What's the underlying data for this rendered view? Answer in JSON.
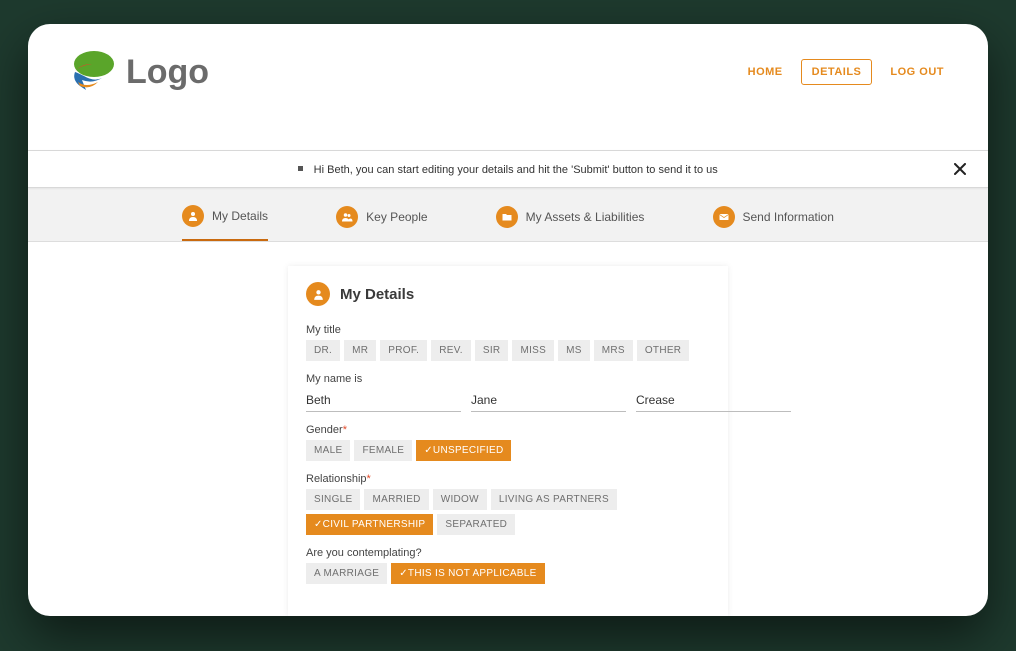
{
  "logo": {
    "text": "Logo"
  },
  "nav": {
    "home": "HOME",
    "details": "DETAILS",
    "logout": "LOG OUT"
  },
  "notice": {
    "text": "Hi Beth, you can start editing your details and hit the 'Submit' button to send it to us"
  },
  "tabs": {
    "my_details": "My Details",
    "key_people": "Key People",
    "assets": "My Assets & Liabilities",
    "send": "Send Information"
  },
  "panel": {
    "title": "My Details",
    "title_label": "My title",
    "titles": [
      "DR.",
      "MR",
      "PROF.",
      "REV.",
      "SIR",
      "MISS",
      "MS",
      "MRS",
      "OTHER"
    ],
    "name_label": "My name is",
    "first": "Beth",
    "middle": "Jane",
    "last": "Crease",
    "gender_label": "Gender",
    "genders": {
      "male": "MALE",
      "female": "FEMALE",
      "unspecified": "✓UNSPECIFIED"
    },
    "relationship_label": "Relationship",
    "relationships": {
      "single": "SINGLE",
      "married": "MARRIED",
      "widow": "WIDOW",
      "living": "LIVING AS PARTNERS",
      "civil": "✓CIVIL PARTNERSHIP",
      "separated": "SEPARATED"
    },
    "contemplate_label": "Are you contemplating?",
    "contemplate": {
      "marriage": "A MARRIAGE",
      "na": "✓THIS IS NOT APPLICABLE"
    }
  }
}
